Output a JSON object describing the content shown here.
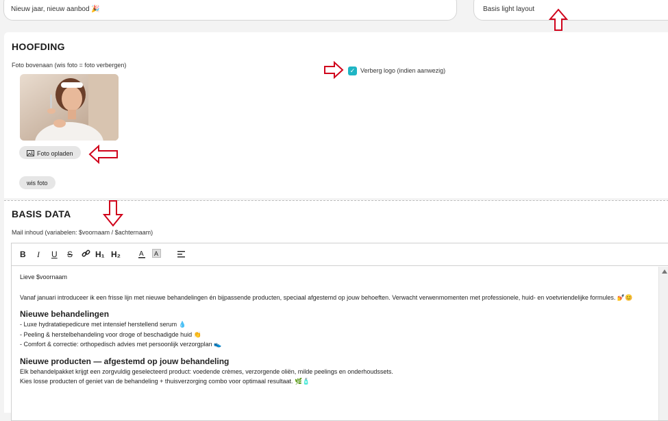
{
  "top": {
    "subject_value": "Nieuw jaar, nieuw aanbod 🎉",
    "layout_value": "Basis light layout"
  },
  "hoofding": {
    "title": "HOOFDING",
    "photo_label": "Foto bovenaan (wis foto = foto verbergen)",
    "hide_logo_label": "Verberg logo (indien aanwezig)",
    "hide_logo_checked": true,
    "upload_label": "Foto opladen",
    "clear_label": "wis foto"
  },
  "basis": {
    "title": "BASIS DATA",
    "mail_label": "Mail inhoud (variabelen: $voornaam / $achternaam)",
    "toolbar": {
      "bold": "B",
      "italic": "I",
      "underline": "U",
      "strike": "S",
      "h1": "H₁",
      "h2": "H₂"
    },
    "content": {
      "greeting": "Lieve $voornaam",
      "intro": "Vanaf januari introduceer ik een frisse lijn met nieuwe behandelingen én bijpassende producten, speciaal afgestemd op jouw behoeften. Verwacht verwenmomenten met professionele, huid- en voetvriendelijke formules. 💅😊",
      "heading1": "Nieuwe behandelingen",
      "list1": [
        "- Luxe hydratatiepedicure met intensief herstellend serum 💧",
        "- Peeling & herstelbehandeling voor droge of beschadigde huid 👏",
        "- Comfort & correctie: orthopedisch advies met persoonlijk verzorgplan 👟"
      ],
      "heading2": "Nieuwe producten — afgestemd op jouw behandeling",
      "para2a": "Elk behandelpakket krijgt een zorgvuldig geselecteerd product: voedende crèmes, verzorgende oliën, milde peelings en onderhoudssets.",
      "para2b": "Kies losse producten of geniet van de behandeling + thuisverzorging combo voor optimaal resultaat. 🌿🧴"
    }
  },
  "colors": {
    "accent": "#1fb5c4",
    "annotation_arrow": "#d0021b"
  }
}
